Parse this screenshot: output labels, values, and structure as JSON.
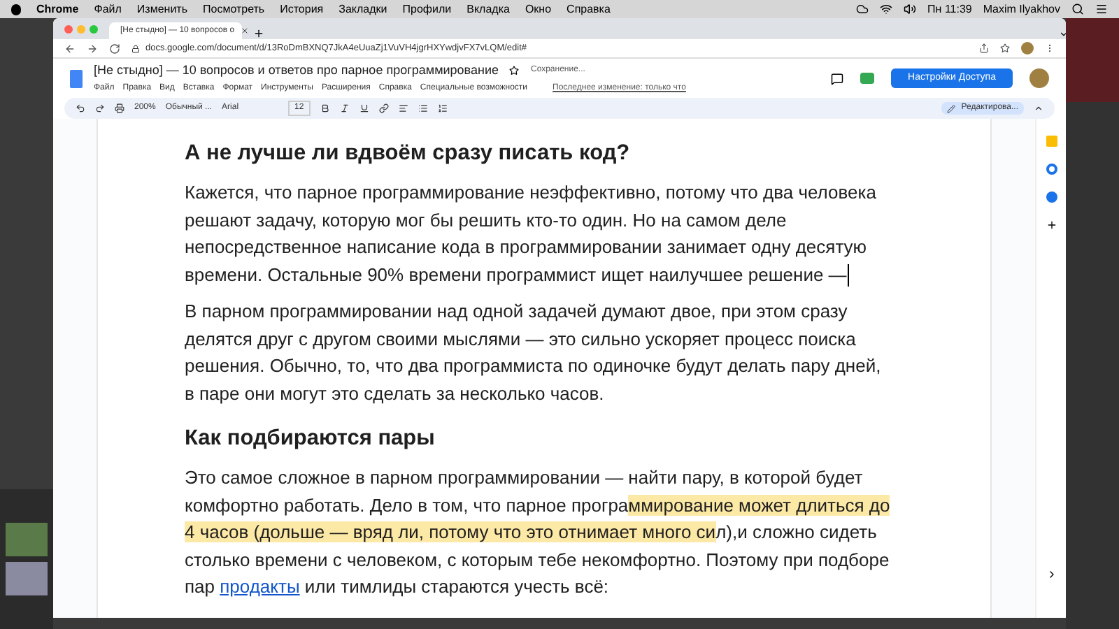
{
  "menubar": {
    "app": "Chrome",
    "items": [
      "Файл",
      "Изменить",
      "Посмотреть",
      "История",
      "Закладки",
      "Профили",
      "Вкладка",
      "Окно",
      "Справка"
    ],
    "clock": "Пн 11:39",
    "user": "Maxim Ilyakhov"
  },
  "browser": {
    "tab_title": "[Не стыдно] — 10 вопросов о",
    "url": "docs.google.com/document/d/13RoDmBXNQ7JkA4eUuaZj1VuVH4jgrHXYwdjvFX7vLQM/edit#"
  },
  "docs": {
    "title": "[Не стыдно] — 10 вопросов и ответов про парное программирование",
    "saving": "Сохранение...",
    "menu": [
      "Файл",
      "Правка",
      "Вид",
      "Вставка",
      "Формат",
      "Инструменты",
      "Расширения",
      "Справка",
      "Специальные возможности"
    ],
    "last_edit": "Последнее изменение: только что",
    "share": "Настройки Доступа",
    "zoom": "200%",
    "style": "Обычный ...",
    "font": "Arial",
    "font_size": "12",
    "mode": "Редактирова..."
  },
  "document": [
    {
      "kind": "heading",
      "runs": [
        {
          "kind": "plain",
          "text": "А не лучше ли вдвоём сразу писать код?"
        }
      ]
    },
    {
      "kind": "paragraph",
      "cursor": true,
      "runs": [
        {
          "kind": "plain",
          "text": "Кажется, что парное программирование неэффективно, потому что два человека решают задачу, которую мог бы решить кто-то один. Но на самом деле непосредственное написание кода в программировании занимает одну десятую времени. Остальные 90% времени программист ищет наилучшее решение —"
        }
      ]
    },
    {
      "kind": "paragraph",
      "cursor": false,
      "runs": [
        {
          "kind": "plain",
          "text": "В парном программировании над одной задачей думают двое, при этом сразу делятся друг с другом своими мыслями — это сильно ускоряет процесс поиска решения. Обычно, то, что два программиста по одиночке будут делать пару дней, в паре они могут это сделать за несколько часов."
        }
      ]
    },
    {
      "kind": "heading",
      "runs": [
        {
          "kind": "plain",
          "text": "Как подбираются пары"
        }
      ]
    },
    {
      "kind": "paragraph",
      "cursor": false,
      "runs": [
        {
          "kind": "plain",
          "text": "Это самое сложное в парном программировании — найти пару, в которой будет комфортно работать. Дело в том, что парное програ"
        },
        {
          "kind": "highlight",
          "text": "ммирование может длиться до 4 часов (дольше — вряд ли, потому что это отнимает много си"
        },
        {
          "kind": "plain",
          "text": "л),и сложно сидеть столько времени с человеком, с которым тебе некомфортно. Поэтому при подборе пар "
        },
        {
          "kind": "link",
          "text": "продакты"
        },
        {
          "kind": "plain",
          "text": " или тимлиды стараются учесть всё:"
        }
      ]
    }
  ]
}
